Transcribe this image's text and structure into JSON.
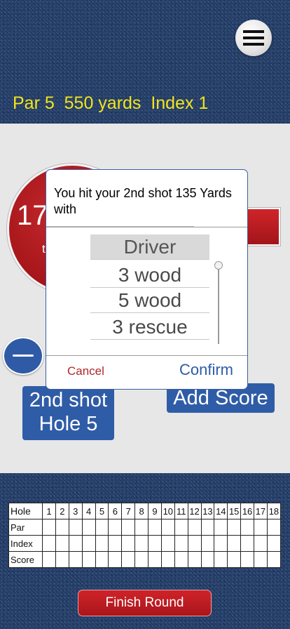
{
  "header": {
    "hole_info": "Par 5  550 yards  Index 1",
    "menu_icon": "hamburger-menu-icon"
  },
  "main": {
    "distance_value": "17",
    "distance_unit": "t",
    "minus_icon": "minus-icon",
    "shot_button_line1": "2nd shot",
    "shot_button_line2": "Hole 5",
    "add_score_label": "Add Score"
  },
  "dialog": {
    "message": "You hit your 2nd shot 135 Yards with",
    "clubs": [
      "Driver",
      "3 wood",
      "5 wood",
      "3 rescue"
    ],
    "selected": "Driver",
    "cancel_label": "Cancel",
    "confirm_label": "Confirm"
  },
  "scorecard": {
    "header_label": "Hole",
    "holes": [
      "1",
      "2",
      "3",
      "4",
      "5",
      "6",
      "7",
      "8",
      "9",
      "10",
      "11",
      "12",
      "13",
      "14",
      "15",
      "16",
      "17",
      "18"
    ],
    "rows": [
      {
        "label": "Par"
      },
      {
        "label": "Index"
      },
      {
        "label": "Score"
      }
    ]
  },
  "footer": {
    "finish_label": "Finish Round"
  },
  "colors": {
    "hole_info": "#f2e51a",
    "button_blue": "#2f5ca7",
    "accent_red": "#b0272a"
  }
}
